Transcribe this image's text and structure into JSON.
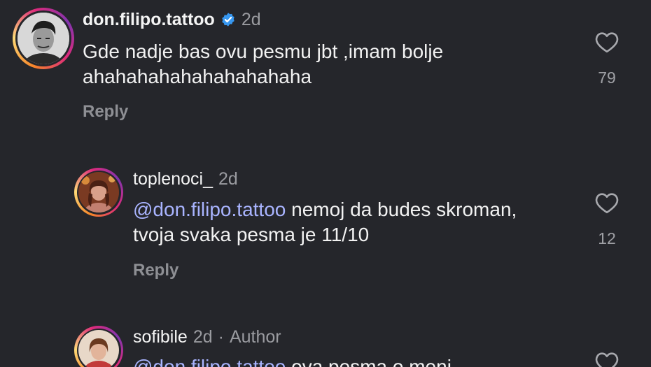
{
  "comments": [
    {
      "username": "don.filipo.tattoo",
      "verified": true,
      "time": "2d",
      "text": "Gde nadje bas ovu pesmu jbt ,imam bolje ahahahahahahahahahaha",
      "reply_label": "Reply",
      "likes": "79"
    },
    {
      "username": "toplenoci_",
      "time": "2d",
      "mention": "@don.filipo.tattoo",
      "text": " nemoj da budes skroman, tvoja svaka pesma je 11/10",
      "reply_label": "Reply",
      "likes": "12"
    },
    {
      "username": "sofibile",
      "time": "2d",
      "separator": "·",
      "author_label": "Author",
      "mention": "@don.filipo.tattoo",
      "text": " ova pesma o meni"
    }
  ],
  "icons": {
    "verified_color": "#3797f0",
    "heart": "heart-outline-icon"
  }
}
